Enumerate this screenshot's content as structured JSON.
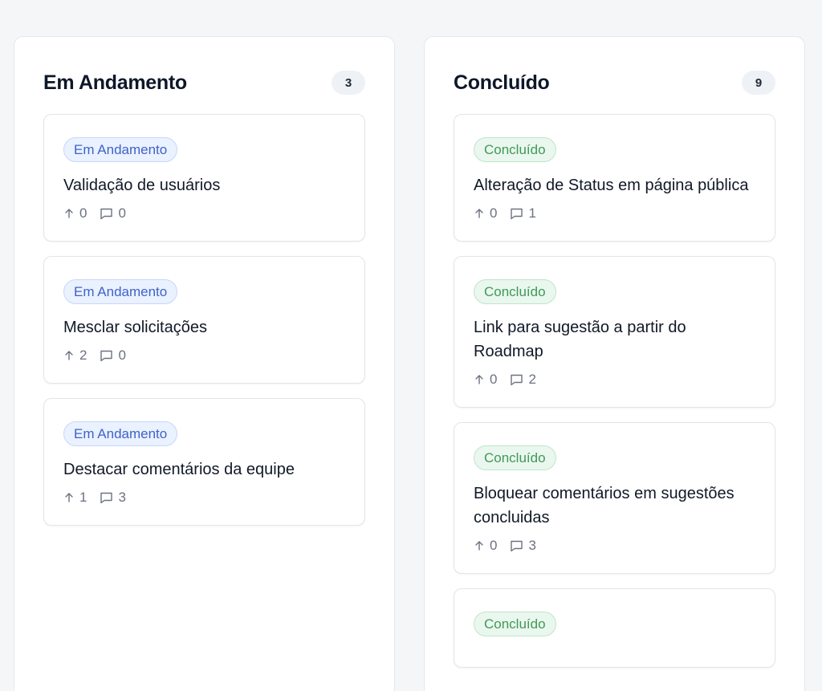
{
  "columns": [
    {
      "title": "Em Andamento",
      "count": "3",
      "cards": [
        {
          "badge": "Em Andamento",
          "title": "Validação de usuários",
          "votes": "0",
          "comments": "0"
        },
        {
          "badge": "Em Andamento",
          "title": "Mesclar solicitações",
          "votes": "2",
          "comments": "0"
        },
        {
          "badge": "Em Andamento",
          "title": "Destacar comentários da equipe",
          "votes": "1",
          "comments": "3"
        }
      ]
    },
    {
      "title": "Concluído",
      "count": "9",
      "cards": [
        {
          "badge": "Concluído",
          "title": "Alteração de Status em página pública",
          "votes": "0",
          "comments": "1"
        },
        {
          "badge": "Concluído",
          "title": "Link para sugestão a partir do Roadmap",
          "votes": "0",
          "comments": "2"
        },
        {
          "badge": "Concluído",
          "title": "Bloquear comentários em sugestões concluidas",
          "votes": "0",
          "comments": "3"
        },
        {
          "badge": "Concluído",
          "title": "",
          "votes": "",
          "comments": ""
        }
      ]
    }
  ],
  "icons": {
    "vote": "arrow-up-icon",
    "comment": "comment-icon"
  },
  "colors": {
    "progress": "#3f63c8",
    "done": "#3f9a57"
  }
}
